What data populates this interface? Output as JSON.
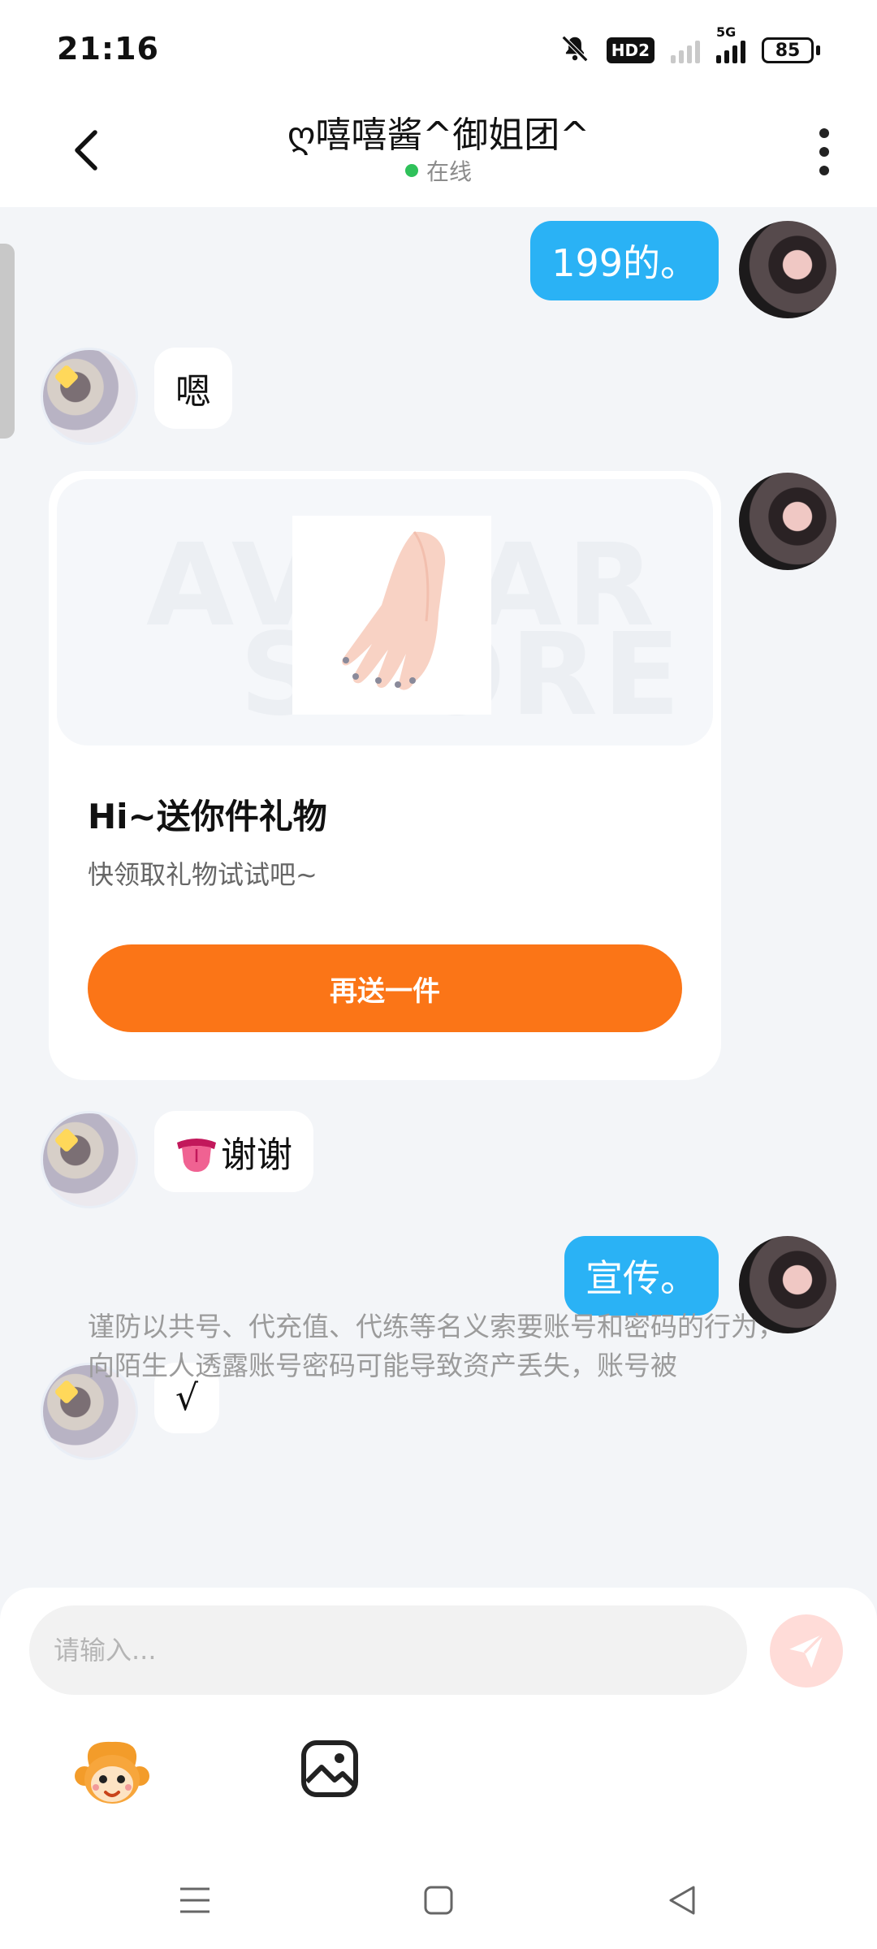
{
  "status_bar": {
    "time": "21:16",
    "hd_label": "HD2",
    "network_label": "5G",
    "battery": "85"
  },
  "header": {
    "title": "ღ嘻嘻酱^御姐团^",
    "online_status": "在线"
  },
  "messages": [
    {
      "side": "out",
      "text": "199的。"
    },
    {
      "side": "in",
      "text": "嗯"
    },
    {
      "side": "out",
      "type": "gift_card"
    },
    {
      "side": "in",
      "text": "谢谢",
      "emoji": "tongue-emoji"
    },
    {
      "side": "out",
      "text": "宣传。"
    },
    {
      "side": "in",
      "text": "√"
    }
  ],
  "gift_card": {
    "title": "Hi~送你件礼物",
    "subtitle": "快领取礼物试试吧~",
    "button": "再送一件"
  },
  "warning": "谨防以共号、代充值、代练等名义索要账号和密码的行为，向陌生人透露账号密码可能导致资产丢失，账号被",
  "input": {
    "placeholder": "请输入..."
  },
  "colors": {
    "outgoing_bubble": "#2ab2f5",
    "gift_button": "#fb7517",
    "online_dot": "#2fc15a",
    "send_button_disabled": "#ffdcd8"
  }
}
